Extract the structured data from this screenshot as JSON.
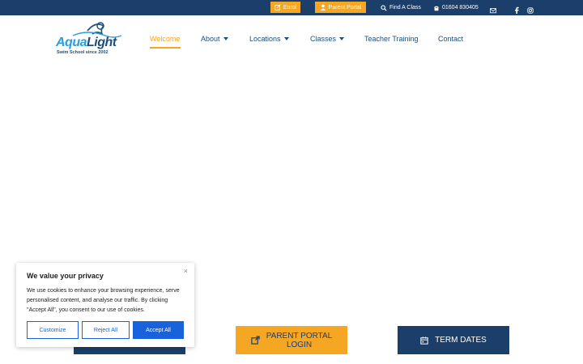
{
  "topbar": {
    "enrol_label": "Enrol",
    "parent_portal_label": "Parent Portal",
    "find_class_label": "Find A Class",
    "phone": "01604 830405"
  },
  "logo": {
    "brand_primary": "Aqua",
    "brand_secondary": "Light",
    "tagline": "Swim School since 2002"
  },
  "nav": {
    "items": [
      {
        "label": "Welcome",
        "active": true
      },
      {
        "label": "About",
        "dropdown": true
      },
      {
        "label": "Locations",
        "dropdown": true
      },
      {
        "label": "Classes",
        "dropdown": true
      },
      {
        "label": "Teacher Training"
      },
      {
        "label": "Contact"
      }
    ]
  },
  "cta": {
    "parent_portal": "PARENT PORTAL LOGIN",
    "term_dates": "TERM DATES"
  },
  "cookie": {
    "title": "We value your privacy",
    "text": "We use cookies to enhance your browsing experience, serve personalised content, and analyse our traffic. By clicking \"Accept All\", you consent to our use of cookies.",
    "customize": "Customize",
    "reject": "Reject All",
    "accept": "Accept All",
    "close": "×"
  },
  "colors": {
    "navy": "#1b3e6b",
    "orange": "#f5a623",
    "nav_text": "#1f4e79",
    "cookie_blue": "#1863dc"
  }
}
